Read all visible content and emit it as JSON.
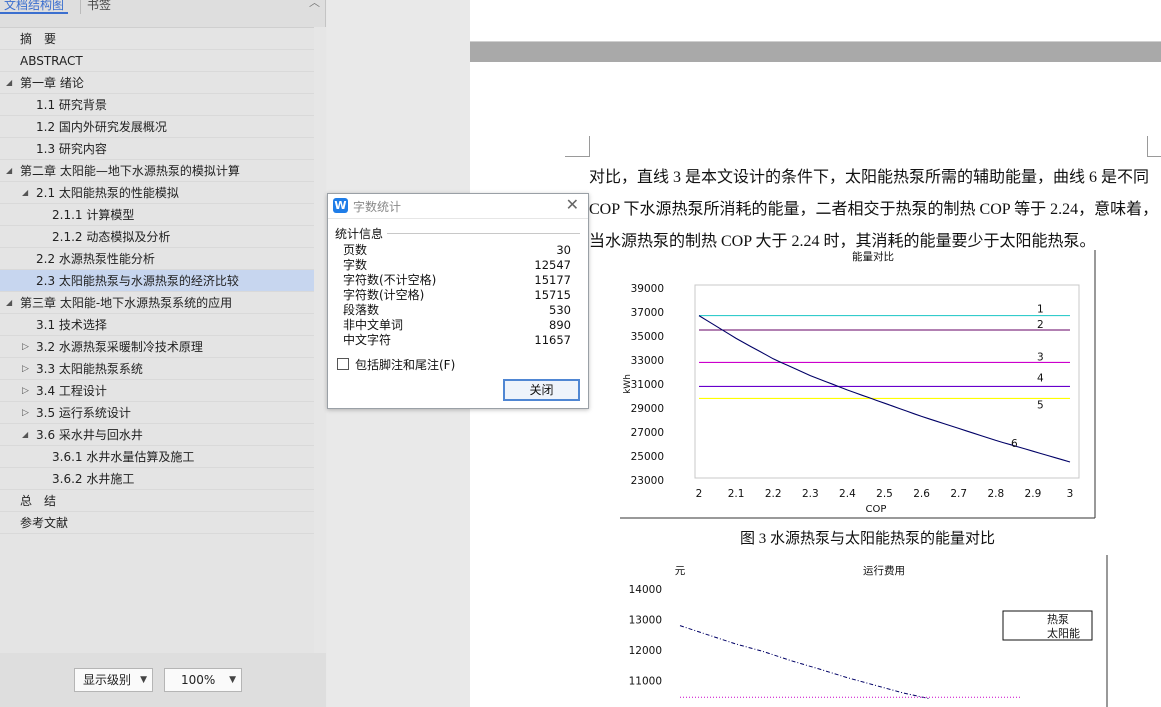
{
  "nav": {
    "tabs": {
      "outline": "文档结构图",
      "bookmark": "书签"
    },
    "collapse_icon": "chevron-up-icon",
    "items": [
      {
        "label": "摘　要"
      },
      {
        "label": "ABSTRACT"
      },
      {
        "label": "第一章 绪论"
      },
      {
        "label": "1.1 研究背景"
      },
      {
        "label": "1.2 国内外研究发展概况"
      },
      {
        "label": "1.3 研究内容"
      },
      {
        "label": "第二章 太阳能—地下水源热泵的模拟计算"
      },
      {
        "label": "2.1 太阳能热泵的性能模拟"
      },
      {
        "label": "2.1.1 计算模型"
      },
      {
        "label": "2.1.2 动态模拟及分析"
      },
      {
        "label": "2.2 水源热泵性能分析"
      },
      {
        "label": "2.3 太阳能热泵与水源热泵的经济比较"
      },
      {
        "label": "第三章 太阳能-地下水源热泵系统的应用"
      },
      {
        "label": "3.1 技术选择"
      },
      {
        "label": "3.2 水源热泵采暖制冷技术原理"
      },
      {
        "label": "3.3 太阳能热泵系统"
      },
      {
        "label": "3.4 工程设计"
      },
      {
        "label": "3.5 运行系统设计"
      },
      {
        "label": "3.6 采水井与回水井"
      },
      {
        "label": "3.6.1 水井水量估算及施工"
      },
      {
        "label": "3.6.2 水井施工"
      },
      {
        "label": "总　结"
      },
      {
        "label": "参考文献"
      }
    ],
    "selected_item": "2.3 太阳能热泵与水源热泵的经济比较",
    "level_select": "显示级别",
    "zoom_select": "100%"
  },
  "document": {
    "paragraph_lines": [
      "对比，直线 3 是本文设计的条件下，太阳能热泵所需的辅助能量，曲线 6 是不同",
      "COP 下水源热泵所消耗的能量，二者相交于热泵的制热 COP 等于 2.24，意味着，",
      "当水源热泵的制热 COP 大于 2.24 时，其消耗的能量要少于太阳能热泵。"
    ],
    "figure_caption": "图 3 水源热泵与太阳能热泵的能量对比"
  },
  "word_count_dialog": {
    "logo": "W",
    "title": "字数统计",
    "close_icon": "close-icon",
    "section": "统计信息",
    "stats": [
      {
        "label": "页数",
        "value": "30"
      },
      {
        "label": "字数",
        "value": "12547"
      },
      {
        "label": "字符数(不计空格)",
        "value": "15177"
      },
      {
        "label": "字符数(计空格)",
        "value": "15715"
      },
      {
        "label": "段落数",
        "value": "530"
      },
      {
        "label": "非中文单词",
        "value": "890"
      },
      {
        "label": "中文字符",
        "value": "11657"
      }
    ],
    "include_footnotes_label": "包括脚注和尾注(F)",
    "include_footnotes_checked": false,
    "close_button": "关闭"
  },
  "chart_data": [
    {
      "type": "line",
      "title": "能量对比",
      "xlabel": "COP",
      "ylabel": "kWh",
      "x": [
        2,
        2.1,
        2.2,
        2.3,
        2.4,
        2.5,
        2.6,
        2.7,
        2.8,
        2.9,
        3
      ],
      "x_tick_labels": [
        "2",
        "2.1",
        "2.2",
        "2.3",
        "2.4",
        "2.5",
        "2.6",
        "2.7",
        "2.8",
        "2.9",
        "3"
      ],
      "ylim": [
        23000,
        39000
      ],
      "y_ticks": [
        23000,
        25000,
        27000,
        29000,
        31000,
        33000,
        35000,
        37000,
        39000
      ],
      "series": [
        {
          "name": "1",
          "color": "#33cccc",
          "values": [
            36700,
            36700,
            36700,
            36700,
            36700,
            36700,
            36700,
            36700,
            36700,
            36700,
            36700
          ]
        },
        {
          "name": "2",
          "color": "#660066",
          "values": [
            35500,
            35500,
            35500,
            35500,
            35500,
            35500,
            35500,
            35500,
            35500,
            35500,
            35500
          ]
        },
        {
          "name": "3",
          "color": "#cc00cc",
          "values": [
            32800,
            32800,
            32800,
            32800,
            32800,
            32800,
            32800,
            32800,
            32800,
            32800,
            32800
          ]
        },
        {
          "name": "4",
          "color": "#6600cc",
          "values": [
            30800,
            30800,
            30800,
            30800,
            30800,
            30800,
            30800,
            30800,
            30800,
            30800,
            30800
          ]
        },
        {
          "name": "5",
          "color": "#ffff00",
          "values": [
            29800,
            29800,
            29800,
            29800,
            29800,
            29800,
            29800,
            29800,
            29800,
            29800,
            29800
          ]
        },
        {
          "name": "6",
          "color": "#000066",
          "values": [
            36700,
            34800,
            33100,
            31700,
            30500,
            29400,
            28300,
            27300,
            26300,
            25400,
            24500
          ]
        }
      ],
      "grid": false
    },
    {
      "type": "line",
      "title": "运行费用",
      "ylabel": "元",
      "y_ticks": [
        11000,
        12000,
        13000,
        14000
      ],
      "series": [
        {
          "name": "热泵",
          "color": "#000066",
          "dash": "dashdot",
          "values": [
            12800,
            12500,
            12200,
            11950,
            11650,
            11380,
            11100,
            10850,
            10600,
            10400
          ]
        },
        {
          "name": "太阳能",
          "color": "#cc00cc",
          "dash": "dotted",
          "values": [
            10450,
            10450,
            10450,
            10450,
            10450,
            10450,
            10450,
            10450,
            10450,
            10450
          ]
        }
      ],
      "legend": "right"
    }
  ]
}
